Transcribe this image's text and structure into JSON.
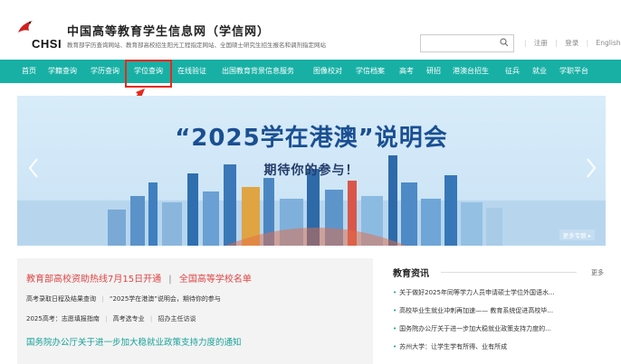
{
  "header": {
    "logo_text": "CHSI",
    "site_title": "中国高等教育学生信息网（学信网）",
    "site_subtitle": "教育部学历查询网站、教育部高校招生阳光工程指定网站、全国硕士研究生招生报名和调剂指定网站",
    "search_placeholder": "",
    "links": [
      "注册",
      "登录",
      "English"
    ]
  },
  "nav": {
    "items": [
      "首页",
      "学籍查询",
      "学历查询",
      "学位查询",
      "在线验证",
      "出国教育背景信息服务",
      "图像校对",
      "学信档案",
      "高考",
      "研招",
      "港澳台招生",
      "征兵",
      "就业",
      "学职平台"
    ]
  },
  "banner": {
    "title": "“2025学在港澳”说明会",
    "subtitle": "期待你的参与！",
    "more_tag": "更多专题 ▸"
  },
  "news_left": {
    "headline_a": "教育部高校资助热线7月15日开通",
    "headline_sep": "|",
    "headline_b": "全国高等学校名单",
    "line2_a": "高考录取日程及结果查询",
    "line2_b": "“2025学在港澳”说明会，期待你的参与",
    "line3_a": "2025高考：志愿填报指南",
    "line3_b": "高考选专业",
    "line3_c": "招办主任访谈",
    "line4": "国务院办公厅关于进一步加大稳就业政策支持力度的通知"
  },
  "news_right": {
    "title": "教育资讯",
    "more": "更多",
    "items": [
      "关于做好2025年同等学力人员申请硕士学位外国语水...",
      "高校毕业生就业冲刺再加速—— 教育系统促进高校毕...",
      "国务院办公厅关于进一步加大稳就业政策支持力度的...",
      "苏州大学：让学生学有所得、业有所成"
    ]
  },
  "colors": {
    "nav_bg": "#18b0a5",
    "highlight": "#e8291b",
    "headline_red": "#e04343",
    "link_teal": "#18a29a"
  }
}
